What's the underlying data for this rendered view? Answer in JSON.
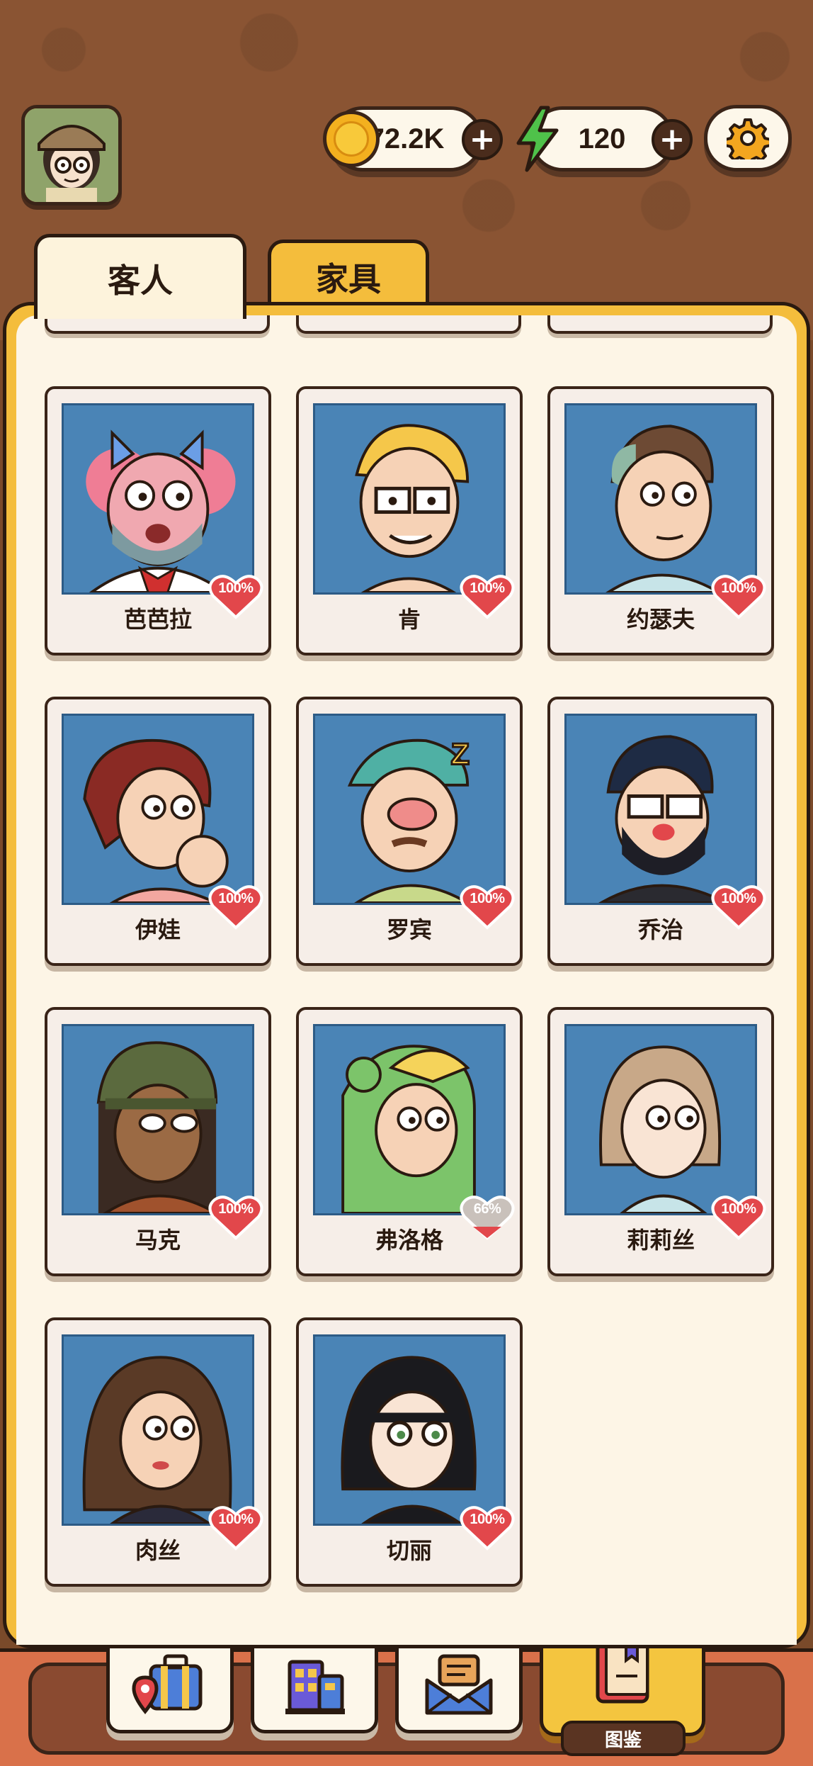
{
  "header": {
    "player_avatar_icon": "detective-girl-avatar",
    "coins": {
      "value": "72.2K",
      "icon": "coin-icon",
      "add_icon": "plus-icon"
    },
    "energy": {
      "value": "120",
      "icon": "lightning-icon",
      "add_icon": "plus-icon"
    },
    "settings_icon": "gear-icon"
  },
  "tabs": [
    {
      "label": "客人",
      "active": true
    },
    {
      "label": "家具",
      "active": false
    }
  ],
  "guests": [
    {
      "name": "芭芭拉",
      "affinity": "100%"
    },
    {
      "name": "肯",
      "affinity": "100%"
    },
    {
      "name": "约瑟夫",
      "affinity": "100%"
    },
    {
      "name": "伊娃",
      "affinity": "100%"
    },
    {
      "name": "罗宾",
      "affinity": "100%"
    },
    {
      "name": "乔治",
      "affinity": "100%"
    },
    {
      "name": "马克",
      "affinity": "100%"
    },
    {
      "name": "弗洛格",
      "affinity": "66%"
    },
    {
      "name": "莉莉丝",
      "affinity": "100%"
    },
    {
      "name": "肉丝",
      "affinity": "100%"
    },
    {
      "name": "切丽",
      "affinity": "100%"
    }
  ],
  "bottom_nav": {
    "items": [
      {
        "icon": "suitcase-map-icon"
      },
      {
        "icon": "building-icon"
      },
      {
        "icon": "mail-icon"
      },
      {
        "icon": "book-icon",
        "label": "图鉴",
        "active": true
      }
    ]
  },
  "colors": {
    "background": "#8a5433",
    "panel_frame": "#f4bd3c",
    "panel_fill": "#fdf5e6",
    "portrait_bg": "#4a84b6",
    "heart": "#e2474b",
    "bottom_bar": "#d9714a"
  }
}
